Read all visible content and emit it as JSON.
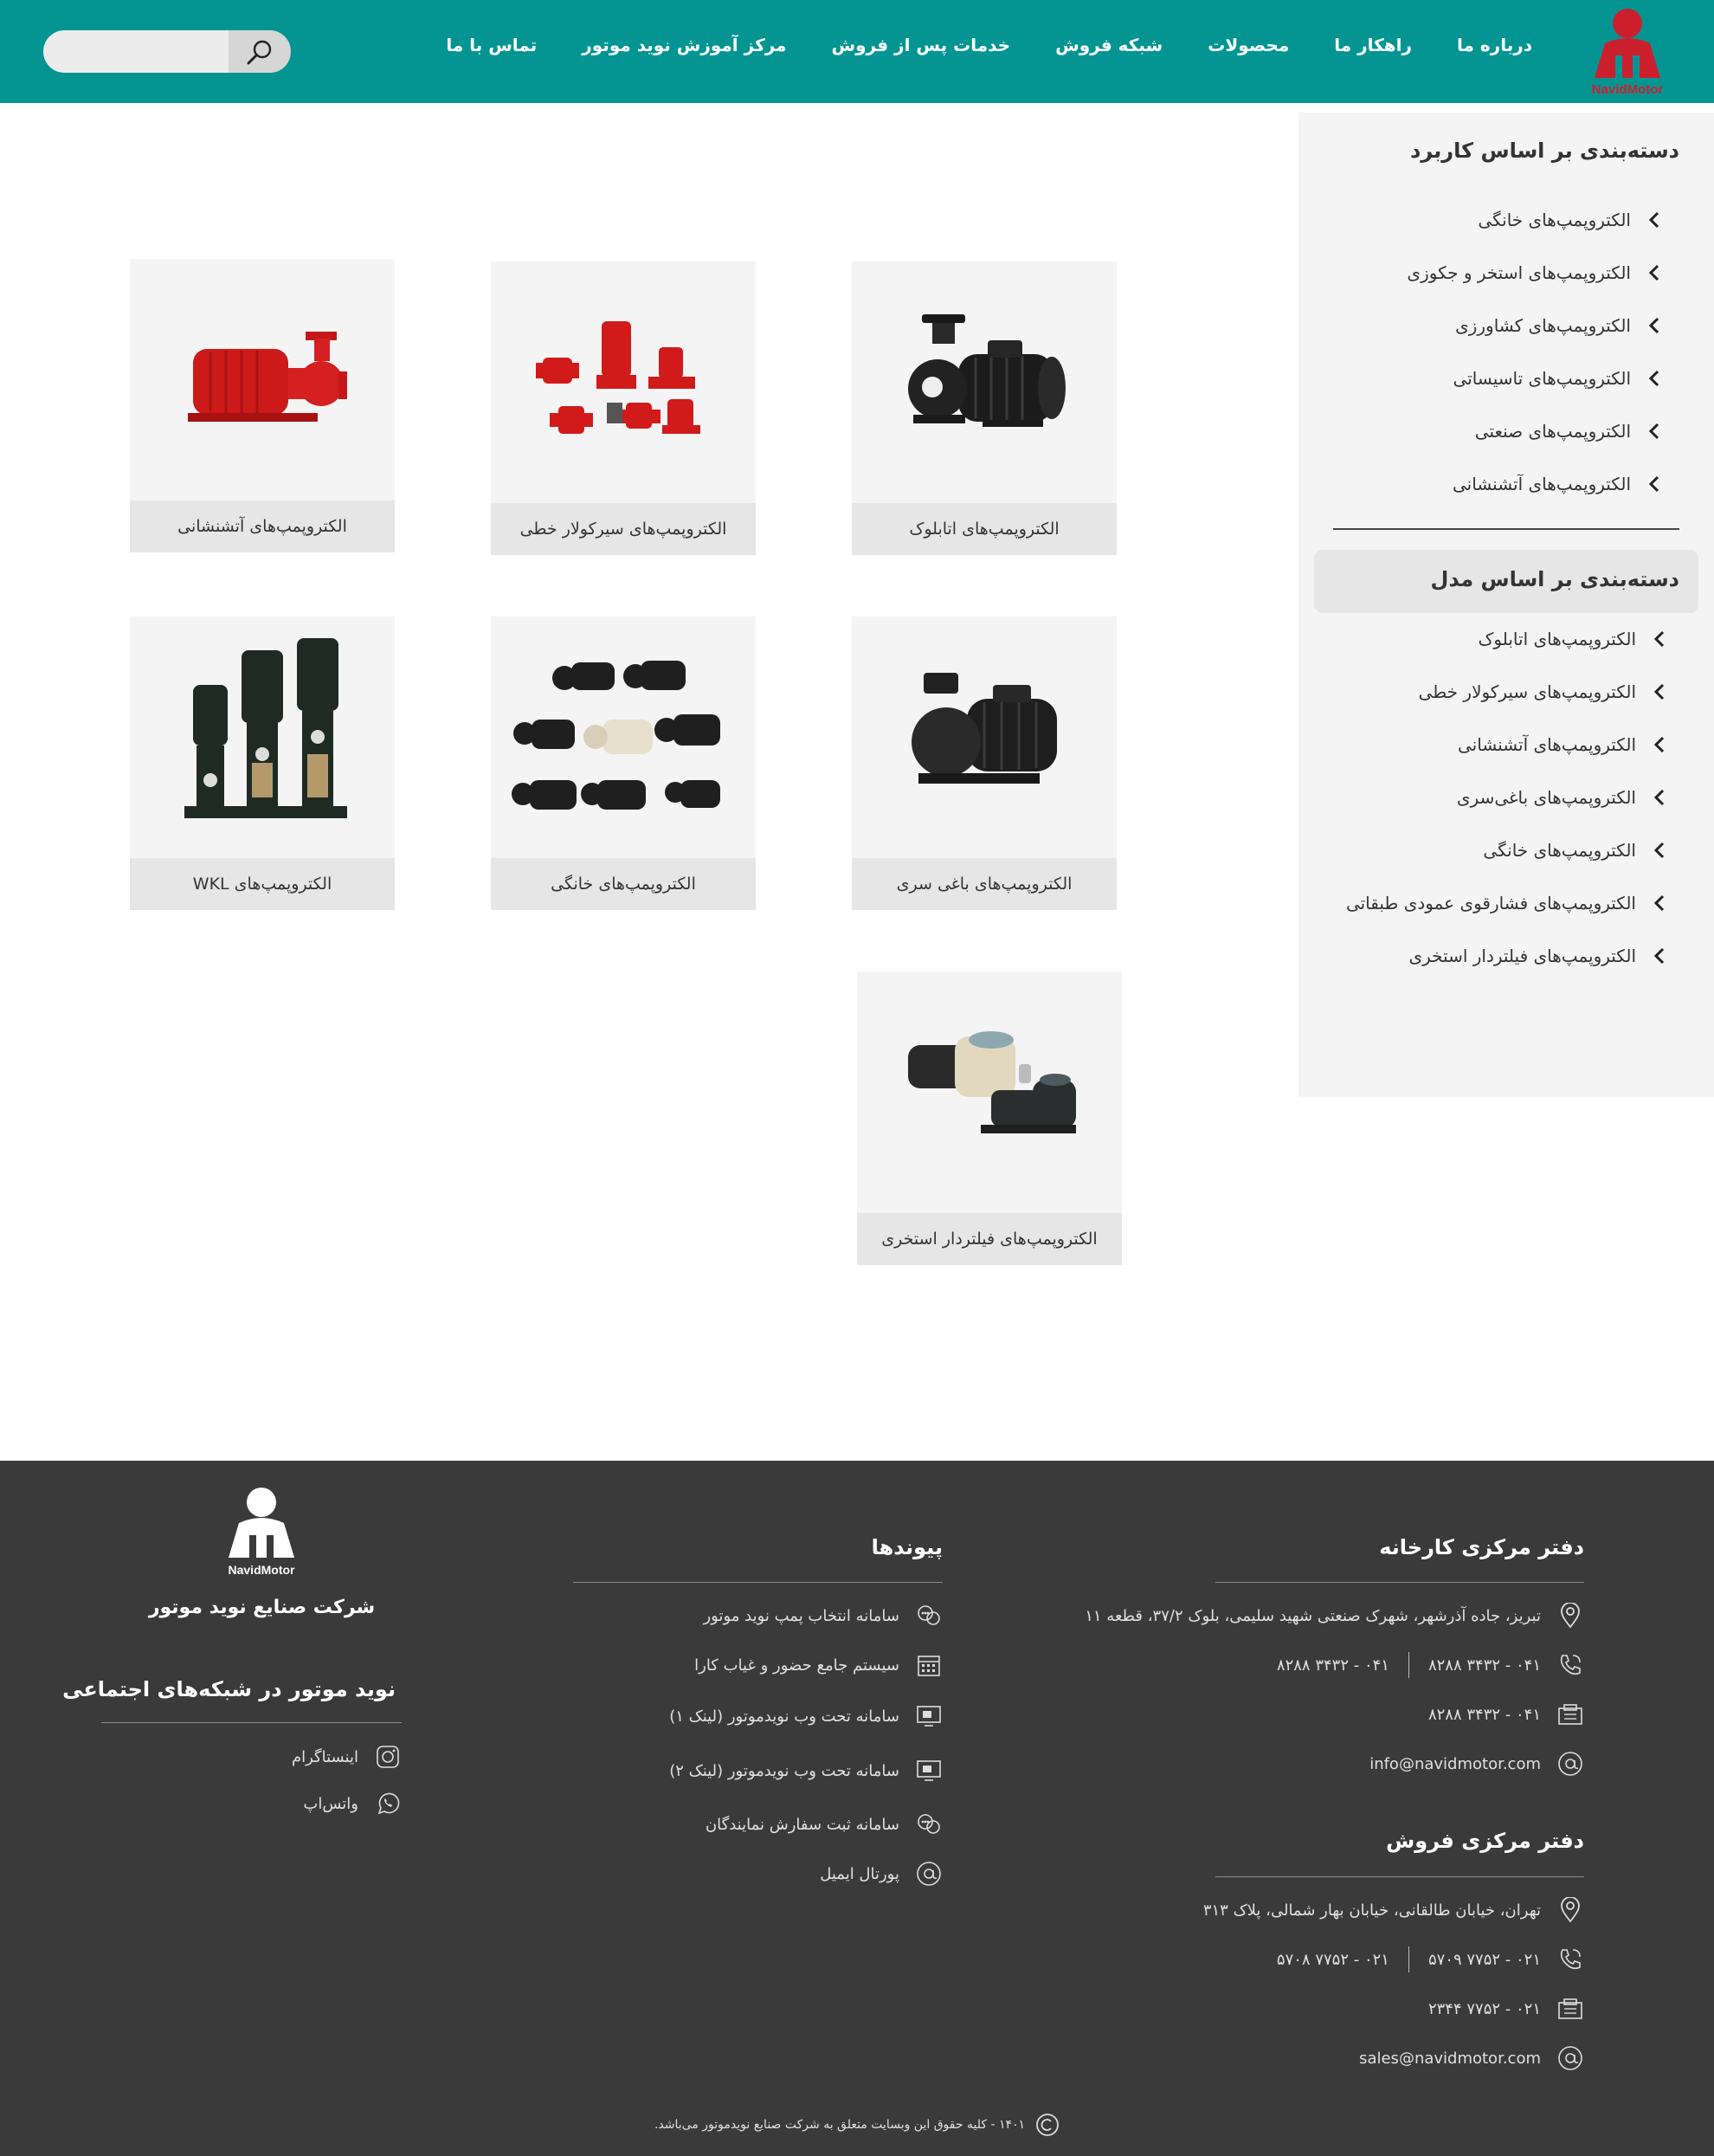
{
  "header": {
    "logo_text": "NavidMotor",
    "nav": [
      "درباره ما",
      "راهکار ما",
      "محصولات",
      "شبکه فروش",
      "خدمات پس از فروش",
      "مرکز آموزش نوید موتور",
      "تماس با ما"
    ],
    "search": {
      "placeholder": "",
      "value": ""
    }
  },
  "sidebar": {
    "usage_title": "دسته‌بندی بر اساس کاربرد",
    "usage_items": [
      "الکتروپمپ‌های خانگی",
      "الکتروپمپ‌های استخر و جکوزی",
      "الکتروپمپ‌های کشاورزی",
      "الکتروپمپ‌های تاسیساتی",
      "الکتروپمپ‌های صنعتی",
      "الکتروپمپ‌های آتشنشانی"
    ],
    "model_title": "دسته‌بندی بر اساس مدل",
    "model_items": [
      "الکتروپمپ‌های اتابلوک",
      "الکتروپمپ‌های سیرکولار خطی",
      "الکتروپمپ‌های آتشنشانی",
      "الکتروپمپ‌های باغی‌سری",
      "الکتروپمپ‌های خانگی",
      "الکتروپمپ‌های فشارقوی عمودی طبقاتی",
      "الکتروپمپ‌های فیلتردار استخری"
    ]
  },
  "products": [
    {
      "label": "الکتروپمپ‌های اتابلوک",
      "image": "black-end-suction-pump"
    },
    {
      "label": "الکتروپمپ‌های سیرکولار خطی",
      "image": "red-inline-circulators"
    },
    {
      "label": "الکتروپمپ‌های آتشنشانی",
      "image": "red-fire-pump"
    },
    {
      "label": "الکتروپمپ‌های باغی سری",
      "image": "black-centrifugal-pump"
    },
    {
      "label": "الکتروپمپ‌های خانگی",
      "image": "household-pumps-group"
    },
    {
      "label": "الکتروپمپ‌های WKL",
      "image": "vertical-multistage-pumps"
    },
    {
      "label": "الکتروپمپ‌های فیلتردار استخری",
      "image": "pool-filter-pumps"
    }
  ],
  "footer": {
    "factory_title": "دفتر مرکزی کارخانه",
    "factory_address": "تبریز، جاده آذرشهر، شهرک صنعتی شهید سلیمی، بلوک ۳۷/۲، قطعه ۱۱",
    "factory_phone_1": "۰۴۱ - ۳۴۳۲ ۸۲۸۸",
    "factory_phone_2": "۰۴۱ - ۳۴۳۲ ۸۲۸۸",
    "factory_fax": "۰۴۱ - ۳۴۳۲ ۸۲۸۸",
    "factory_email": "info@navidmotor.com",
    "sales_title": "دفتر مرکزی فروش",
    "sales_address": "تهران، خیابان طالقانی، خیابان بهار شمالی، پلاک ۳۱۳",
    "sales_phone_1": "۰۲۱ - ۷۷۵۲ ۵۷۰۹",
    "sales_phone_2": "۰۲۱ - ۷۷۵۲ ۵۷۰۸",
    "sales_fax": "۰۲۱ - ۷۷۵۲ ۲۳۴۴",
    "sales_email": "sales@navidmotor.com",
    "links_title": "پیوندها",
    "links": [
      {
        "label": "سامانه انتخاب پمپ نوید موتور",
        "icon": "chat-bubbles-icon"
      },
      {
        "label": "سیستم جامع حضور و غیاب کارا",
        "icon": "calendar-icon"
      },
      {
        "label": "سامانه تحت وب نویدموتور (لینک ۱)",
        "icon": "monitor-icon"
      },
      {
        "label": "سامانه تحت وب نویدموتور (لینک ۲)",
        "icon": "monitor-icon"
      },
      {
        "label": "سامانه ثبت سفارش نمایندگان",
        "icon": "chat-bubbles-icon"
      },
      {
        "label": "پورتال ایمیل",
        "icon": "at-icon"
      }
    ],
    "company_logo_text": "NavidMotor",
    "company_name": "شرکت صنایع نوید موتور",
    "social_title": "نوید موتور در شبکه‌های اجتماعی",
    "social": [
      {
        "label": "اینستاگرام",
        "icon": "instagram-icon"
      },
      {
        "label": "واتس‌اپ",
        "icon": "whatsapp-icon"
      }
    ],
    "copyright": "۱۴۰۱ - کلیه حقوق این وبسایت متعلق به شرکت صنایع نویدموتور می‌باشد."
  },
  "colors": {
    "header_bg": "#049593",
    "footer_bg": "#3a3a3a",
    "logo_red": "#cc1f2e"
  }
}
